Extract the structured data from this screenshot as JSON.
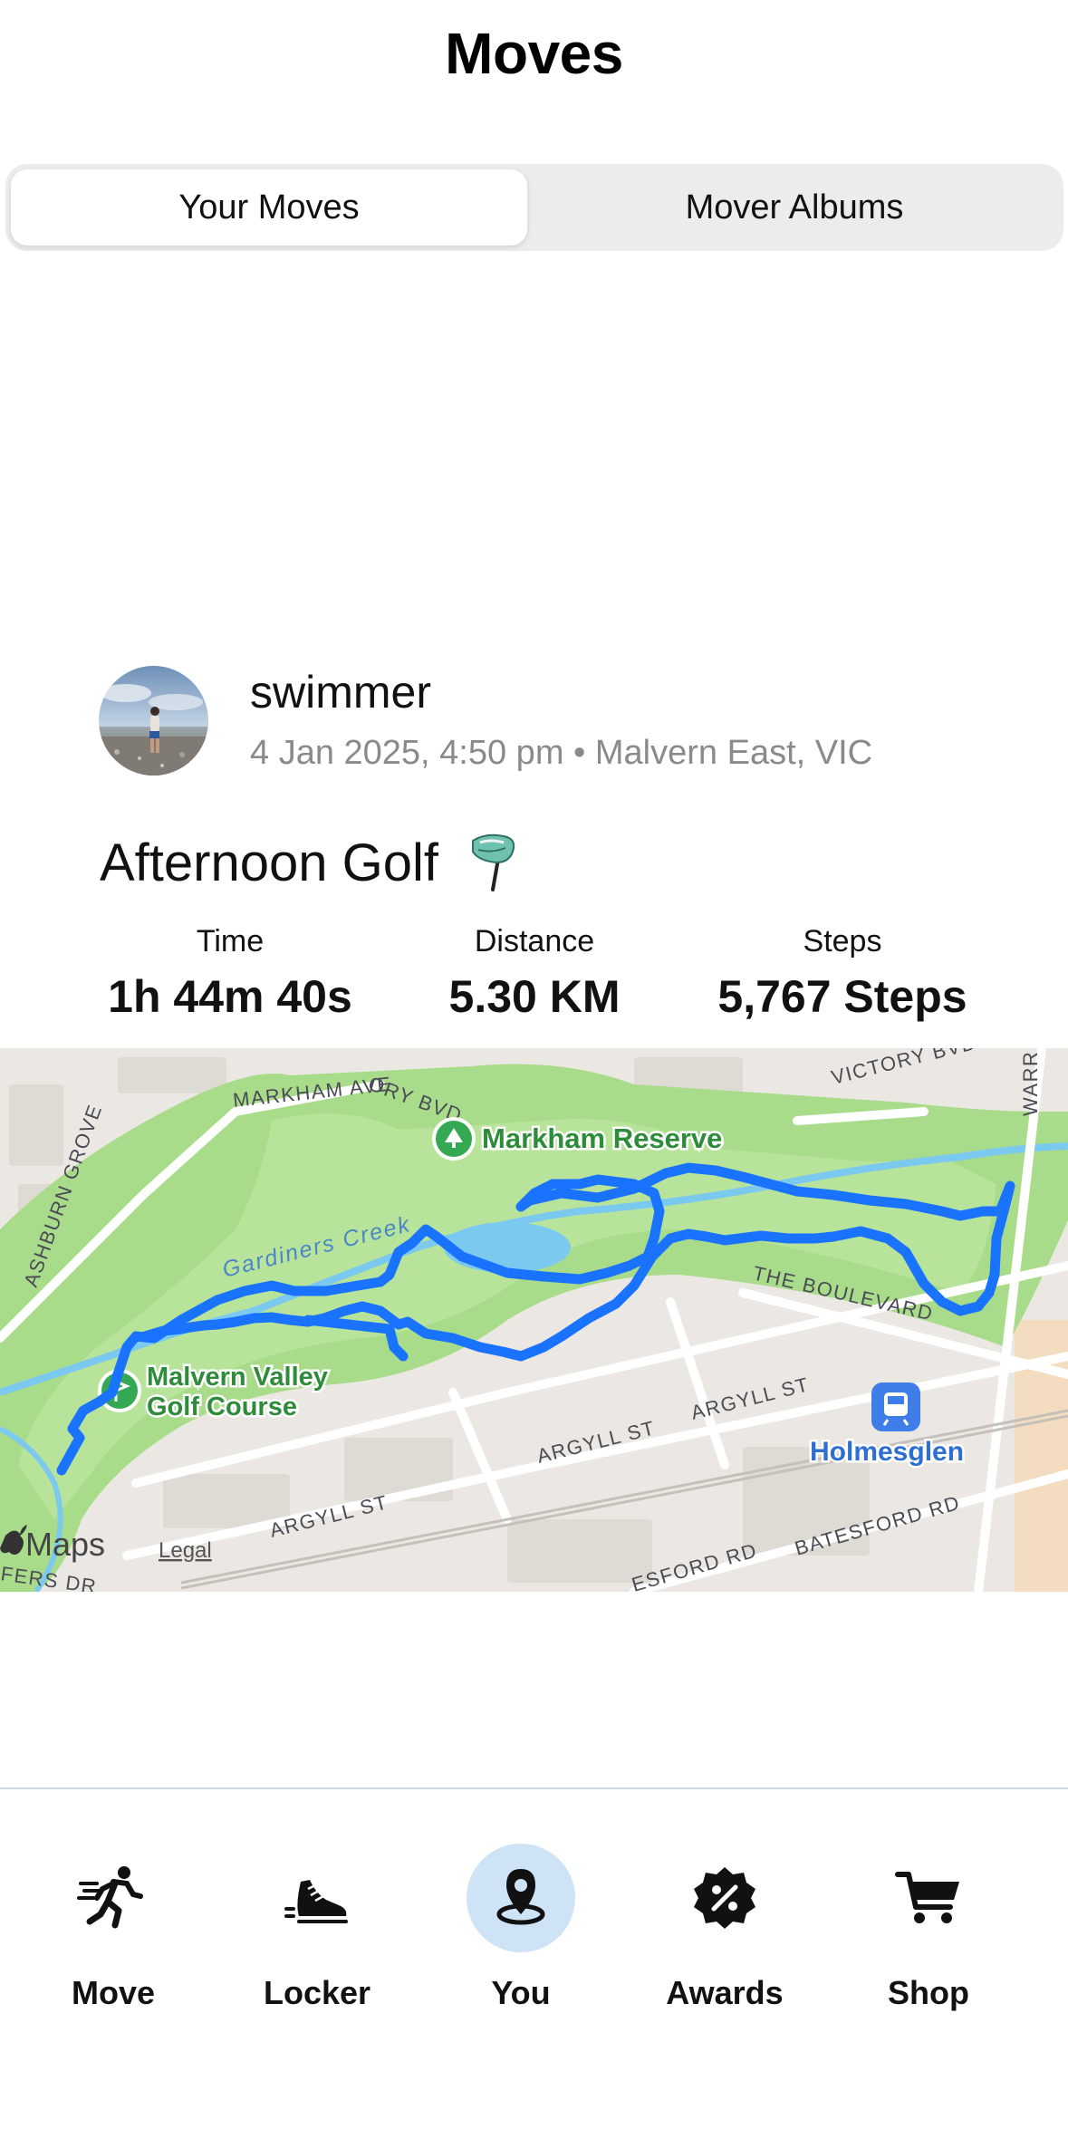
{
  "header": {
    "title": "Moves"
  },
  "segments": {
    "active_label": "Your Moves",
    "inactive_label": "Mover Albums"
  },
  "post": {
    "username": "swimmer",
    "meta": "4 Jan 2025, 4:50 pm • Malvern East, VIC",
    "activity_title": "Afternoon Golf",
    "stats": [
      {
        "label": "Time",
        "value": "1h 44m 40s"
      },
      {
        "label": "Distance",
        "value": "5.30 KM"
      },
      {
        "label": "Steps",
        "value": "5,767 Steps"
      }
    ]
  },
  "map": {
    "labels": {
      "markham_reserve": "Markham Reserve",
      "golf_course_line1": "Malvern Valley",
      "golf_course_line2": "Golf Course",
      "gardiners_creek": "Gardiners Creek",
      "holmesglen": "Holmesglen",
      "markham_ave": "MARKHAM AVE",
      "victory_bvd_left": "ORY BVD",
      "victory_bvd_right": "VICTORY BVD",
      "ashburn_grove": "ASHBURN GROVE",
      "the_boulevard": "THE BOULEVARD",
      "argyll_st_1": "ARGYLL ST",
      "argyll_st_2": "ARGYLL ST",
      "argyll_st_3": "ARGYLL ST",
      "batesford_rd_1": "BATESFORD RD",
      "batesford_rd_2": "ESFORD RD",
      "warr": "WARR",
      "fers_dr": "FERS DR",
      "maps_brand": "Maps",
      "legal": "Legal"
    },
    "route_color": "#1a73ff",
    "park_color": "#a9dc8a",
    "water_color": "#7cc9f0"
  },
  "tabbar": {
    "tabs": [
      {
        "label": "Move",
        "icon": "running-person-icon"
      },
      {
        "label": "Locker",
        "icon": "shoe-icon"
      },
      {
        "label": "You",
        "icon": "location-pin-icon",
        "active": true
      },
      {
        "label": "Awards",
        "icon": "percent-badge-icon"
      },
      {
        "label": "Shop",
        "icon": "shopping-cart-icon"
      }
    ]
  }
}
